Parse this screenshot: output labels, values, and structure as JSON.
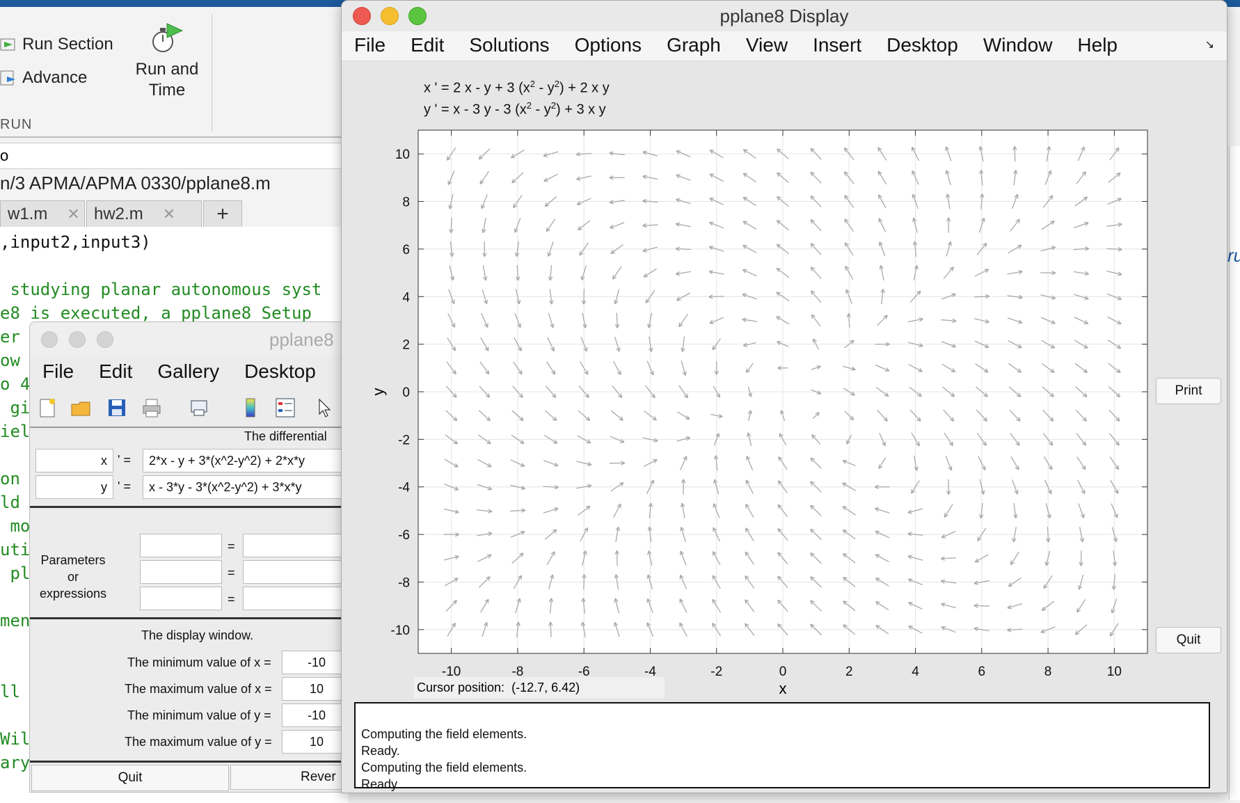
{
  "matlab": {
    "run_section": "Run Section",
    "advance": "Advance",
    "run_and_time_1": "Run and",
    "run_and_time_2": "Time",
    "run_group": "RUN",
    "address": "o",
    "path": "n/3 APMA/APMA 0330/pplane8.m",
    "tabs": [
      {
        "label": "w1.m"
      },
      {
        "label": "hw2.m"
      }
    ],
    "add_tab": "+",
    "code_lines": [
      ",input2,input3)",
      "",
      " studying planar autonomous syst",
      "e8 is executed, a pplane8 Setup",
      "er",
      "ow",
      "o 4",
      " gi",
      "iel",
      "",
      "on",
      "ld",
      " mo",
      "uti",
      " pl",
      "",
      "men",
      "",
      "",
      "ll",
      "",
      "Wil",
      "ary"
    ],
    "right_text": "ru"
  },
  "setup": {
    "title": "pplane8",
    "menu": [
      "File",
      "Edit",
      "Gallery",
      "Desktop"
    ],
    "section_heading": "The differential",
    "var_x": "x",
    "var_y": "y",
    "prime_eq": "' =",
    "x_eq": "2*x - y + 3*(x^2-y^2) + 2*x*y",
    "y_eq": "x - 3*y - 3*(x^2-y^2) + 3*x*y",
    "params_label_1": "Parameters",
    "params_label_2": "or",
    "params_label_3": "expressions",
    "equals": "=",
    "display_heading": "The display window.",
    "xmin_label": "The minimum value of x =",
    "xmax_label": "The maximum value of x =",
    "ymin_label": "The minimum value of y =",
    "ymax_label": "The maximum value of y =",
    "xmin": "-10",
    "xmax": "10",
    "ymin": "-10",
    "ymax": "10",
    "quit": "Quit",
    "revert": "Rever"
  },
  "display": {
    "title": "pplane8 Display",
    "menu": [
      "File",
      "Edit",
      "Solutions",
      "Options",
      "Graph",
      "View",
      "Insert",
      "Desktop",
      "Window",
      "Help"
    ],
    "eq_x": {
      "pre": "x ' = 2 x - y + 3 (x",
      "sup1": "2",
      "mid": " - y",
      "sup2": "2",
      "post": ") + 2 x y"
    },
    "eq_y": {
      "pre": "y ' = x - 3 y - 3 (x",
      "sup1": "2",
      "mid": " - y",
      "sup2": "2",
      "post": ") + 3 x y"
    },
    "xlabel": "x",
    "ylabel": "y",
    "print": "Print",
    "quit": "Quit",
    "cursor_label": "Cursor position:",
    "cursor_value": "(-12.7, 6.42)",
    "messages": [
      "Computing the field elements.",
      "Ready.",
      "Computing the field elements.",
      "Ready."
    ]
  },
  "chart_data": {
    "type": "direction-field",
    "xlim": [
      -11,
      11
    ],
    "ylim": [
      -11,
      11
    ],
    "xticks": [
      -10,
      -8,
      -6,
      -4,
      -2,
      0,
      2,
      4,
      6,
      8,
      10
    ],
    "yticks": [
      -10,
      -8,
      -6,
      -4,
      -2,
      0,
      2,
      4,
      6,
      8,
      10
    ],
    "grid": true,
    "field_x_formula": "2*x - y + 3*(x^2-y^2) + 2*x*y",
    "field_y_formula": "x - 3*y - 3*(x^2-y^2) + 3*x*y",
    "arrow_color": "#a9a9a9"
  }
}
